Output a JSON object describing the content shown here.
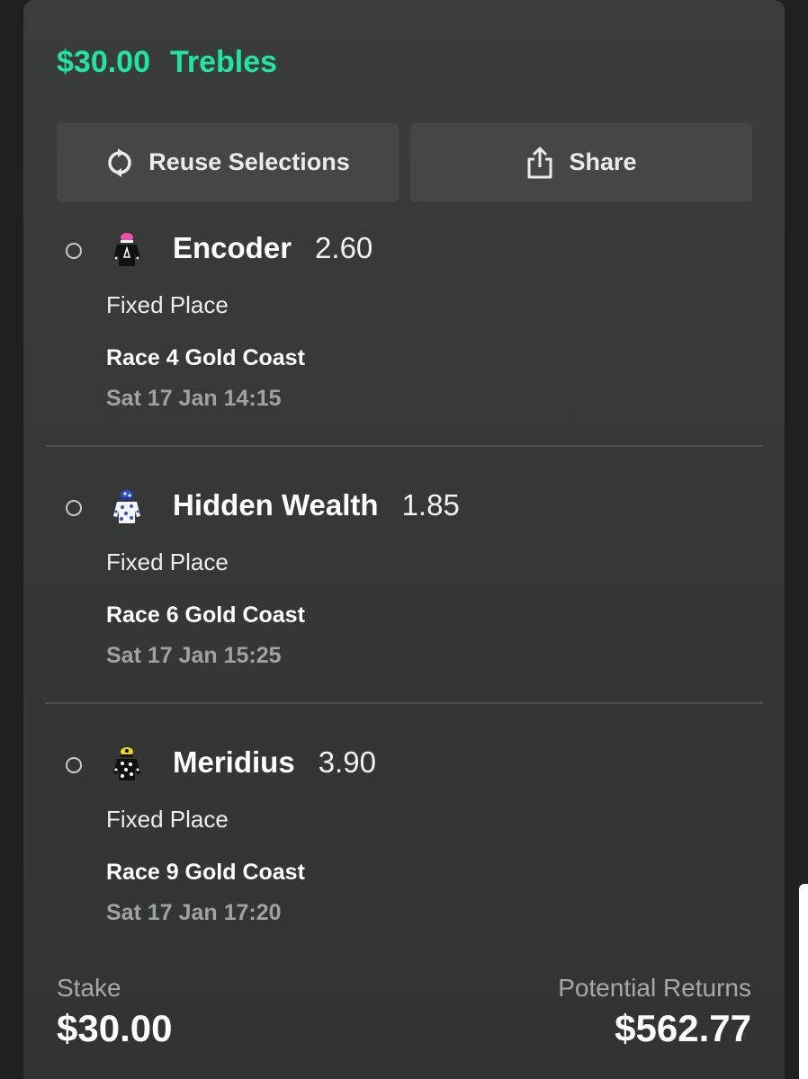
{
  "bet": {
    "amount": "$30.00",
    "type": "Trebles",
    "accent_color": "#22e3a6"
  },
  "actions": {
    "reuse_label": "Reuse Selections",
    "reuse_icon": "refresh-icon",
    "share_label": "Share",
    "share_icon": "share-icon"
  },
  "selections": [
    {
      "name": "Encoder",
      "odds": "2.60",
      "market": "Fixed Place",
      "race": "Race 4 Gold Coast",
      "time": "Sat 17 Jan 14:15",
      "silk_icon": "jockey-silk-black-pink-icon"
    },
    {
      "name": "Hidden Wealth",
      "odds": "1.85",
      "market": "Fixed Place",
      "race": "Race 6 Gold Coast",
      "time": "Sat 17 Jan 15:25",
      "silk_icon": "jockey-silk-white-blue-icon"
    },
    {
      "name": "Meridius",
      "odds": "3.90",
      "market": "Fixed Place",
      "race": "Race 9 Gold Coast",
      "time": "Sat 17 Jan 17:20",
      "silk_icon": "jockey-silk-black-white-spots-icon"
    }
  ],
  "footer": {
    "stake_label": "Stake",
    "stake_value": "$30.00",
    "returns_label": "Potential Returns",
    "returns_value": "$562.77"
  }
}
